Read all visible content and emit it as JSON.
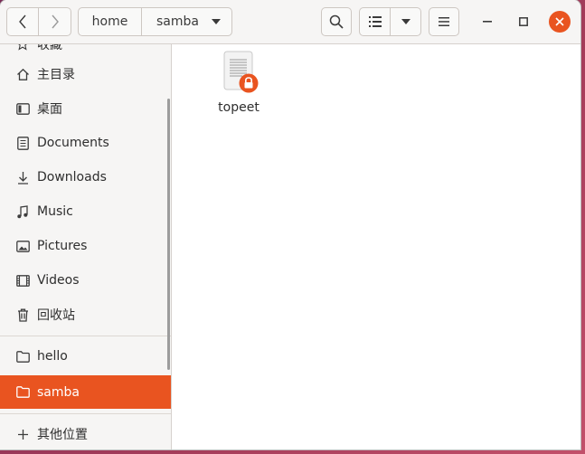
{
  "window": {
    "accent": "#e95420"
  },
  "toolbar": {
    "back_icon": "chevron-left-icon",
    "forward_icon": "chevron-right-icon",
    "path": [
      "home",
      "samba"
    ],
    "search_icon": "search-icon",
    "view_icon": "list-view-icon",
    "menu_icon": "hamburger-menu-icon"
  },
  "sidebar": {
    "top_partial": "收藏",
    "places": [
      {
        "label": "主目录",
        "icon": "home-icon"
      },
      {
        "label": "桌面",
        "icon": "desktop-icon"
      },
      {
        "label": "Documents",
        "icon": "document-icon"
      },
      {
        "label": "Downloads",
        "icon": "download-icon"
      },
      {
        "label": "Music",
        "icon": "music-icon"
      },
      {
        "label": "Pictures",
        "icon": "picture-icon"
      },
      {
        "label": "Videos",
        "icon": "video-icon"
      },
      {
        "label": "回收站",
        "icon": "trash-icon"
      }
    ],
    "bookmarks": [
      {
        "label": "hello",
        "icon": "folder-icon"
      },
      {
        "label": "samba",
        "icon": "folder-icon",
        "active": true
      }
    ],
    "other": {
      "label": "其他位置",
      "icon": "plus-icon"
    }
  },
  "files": [
    {
      "name": "topeet",
      "icon": "text-file-icon",
      "badge": "lock-icon"
    }
  ]
}
